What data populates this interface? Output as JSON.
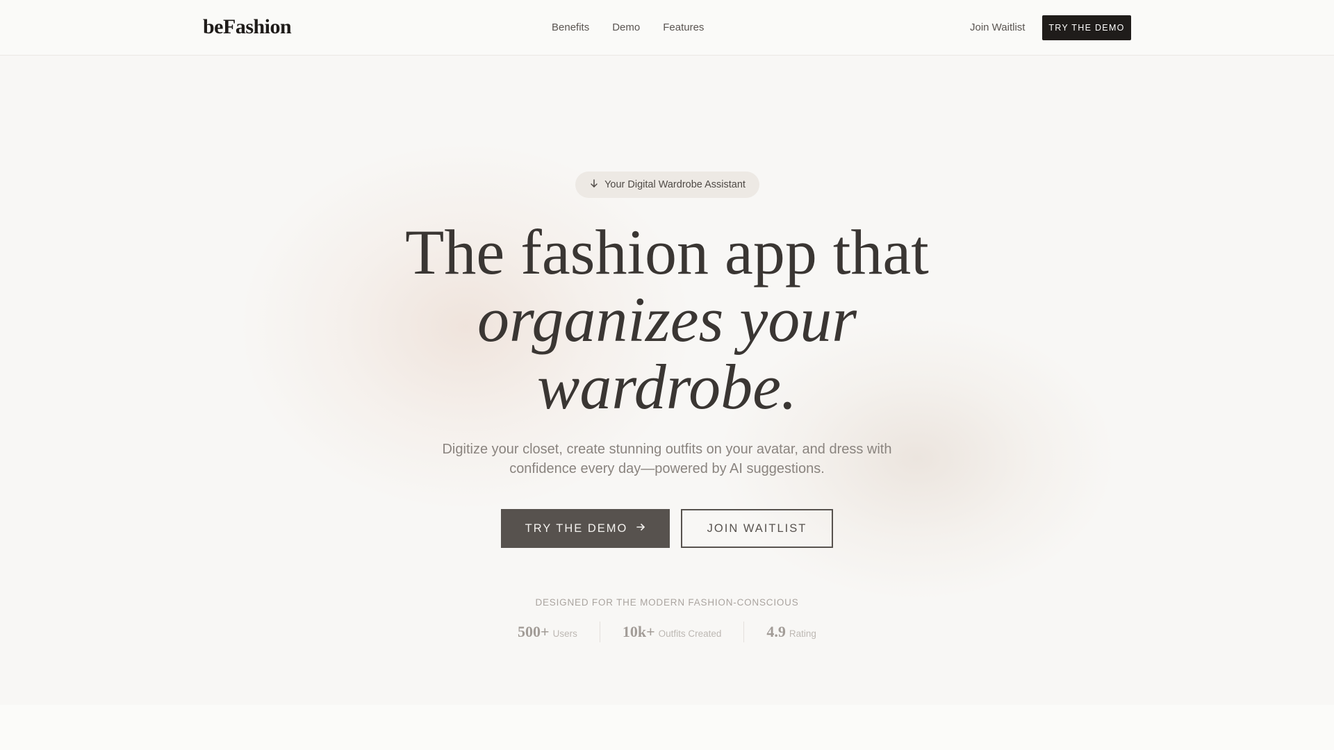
{
  "header": {
    "logo": "beFashion",
    "nav": [
      "Benefits",
      "Demo",
      "Features"
    ],
    "waitlist_link": "Join Waitlist",
    "cta": "TRY THE DEMO"
  },
  "hero": {
    "badge_icon": "arrow-down-icon",
    "badge": "Your Digital Wardrobe Assistant",
    "headline_line1": "The fashion app that",
    "headline_line2": "organizes your",
    "headline_line3": "wardrobe.",
    "subtext": "Digitize your closet, create stunning outfits on your avatar, and dress with confidence every day—powered by AI suggestions.",
    "primary_button": "TRY THE DEMO",
    "primary_button_icon": "arrow-right-icon",
    "secondary_button": "JOIN WAITLIST",
    "designed_for": "DESIGNED FOR THE MODERN FASHION-CONSCIOUS"
  },
  "stats": [
    {
      "value": "500+",
      "label": "Users"
    },
    {
      "value": "10k+",
      "label": "Outfits Created"
    },
    {
      "value": "4.9",
      "label": "Rating"
    }
  ],
  "colors": {
    "background": "#f8f7f5",
    "dark": "#1f1c1a",
    "primary_button": "#57524e"
  }
}
